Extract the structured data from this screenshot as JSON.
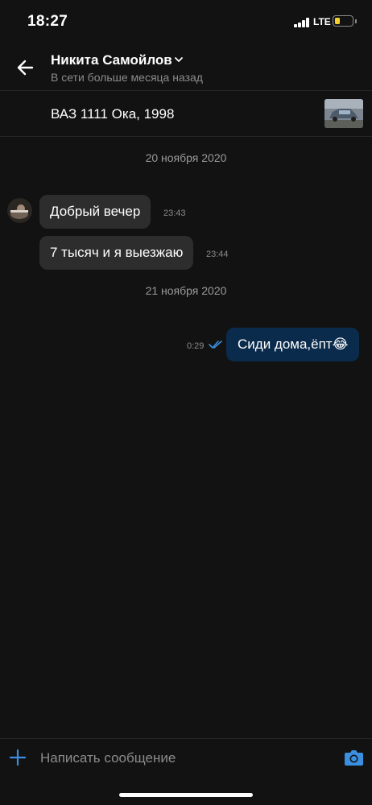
{
  "status_bar": {
    "time": "18:27",
    "network": "LTE",
    "battery_level": 0.3
  },
  "header": {
    "contact_name": "Никита Самойлов",
    "contact_status": "В сети больше месяца назад",
    "back_icon": "arrow-left-icon",
    "dropdown_icon": "chevron-down-icon"
  },
  "listing": {
    "title": "ВАЗ 1111 Ока, 1998",
    "thumbnail": "car-photo"
  },
  "messages": {
    "date1": "20 ноября 2020",
    "m1": {
      "text": "Добрый вечер",
      "time": "23:43"
    },
    "m2": {
      "text": "7 тысяч и я выезжаю",
      "time": "23:44"
    },
    "date2": "21 ноября 2020",
    "m3": {
      "text": "Сиди дома,ёпт😂",
      "time": "0:29",
      "status": "read"
    }
  },
  "composer": {
    "placeholder": "Написать сообщение",
    "value": "",
    "add_icon": "plus-icon",
    "camera_icon": "camera-icon"
  },
  "colors": {
    "background": "#121212",
    "incoming_bubble": "#2d2d2d",
    "outgoing_bubble": "#0b2b4c",
    "accent": "#3b8fe0",
    "battery": "#f3d02c"
  }
}
